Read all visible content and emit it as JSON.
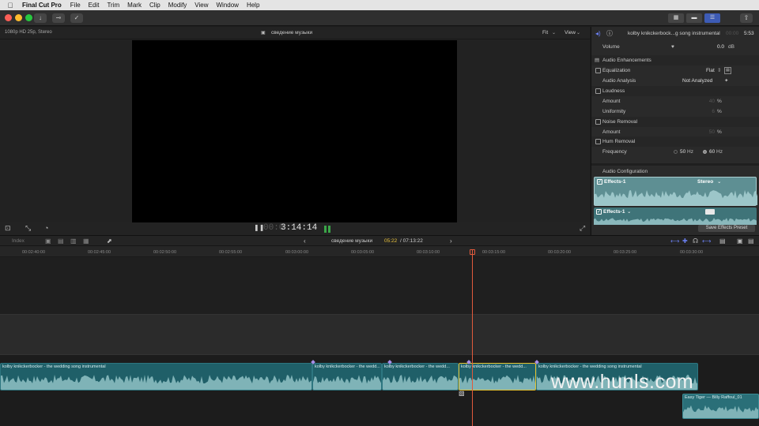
{
  "menubar": {
    "app": "Final Cut Pro",
    "items": [
      "File",
      "Edit",
      "Trim",
      "Mark",
      "Clip",
      "Modify",
      "View",
      "Window",
      "Help"
    ]
  },
  "viewer": {
    "format": "1080p HD 25p, Stereo",
    "title": "сведение музыки",
    "fit": "Fit",
    "view": "View",
    "timecode_dim": "00:0",
    "timecode": "3:14:14"
  },
  "inspector": {
    "clip_name": "kolby knikckerbock...g song instrumental",
    "duration": "5:53",
    "volume_label": "Volume",
    "volume_value": "0.0",
    "volume_unit": "dB",
    "audio_enhancements": "Audio Enhancements",
    "equalization": "Equalization",
    "equalization_value": "Flat",
    "audio_analysis": "Audio Analysis",
    "audio_analysis_value": "Not Analyzed",
    "loudness": "Loudness",
    "amount": "Amount",
    "loudness_amount": "40",
    "percent": "%",
    "uniformity": "Uniformity",
    "uniformity_value": "6",
    "noise_removal": "Noise Removal",
    "noise_amount": "50",
    "hum_removal": "Hum Removal",
    "frequency": "Frequency",
    "freq_50": "50",
    "freq_60": "60",
    "hz": "Hz",
    "audio_configuration": "Audio Configuration",
    "effects_1": "Effects-1",
    "stereo": "Stereo",
    "effects_2": "Effects-1",
    "save_preset": "Save Effects Preset"
  },
  "timeline": {
    "index": "Index",
    "project": "сведение музыки",
    "position": "05:22",
    "total": "/ 07:13:22",
    "ruler": [
      "00:02:40:00",
      "00:02:45:00",
      "00:02:50:00",
      "00:02:55:00",
      "00:03:00:00",
      "00:03:05:00",
      "00:03:10:00",
      "00:03:15:00",
      "00:03:20:00",
      "00:03:25:00",
      "00:03:30:00"
    ],
    "clips": [
      "kolby knikckerbocker - the wedding song instrumental",
      "kolby knikckerbocker - the wedd...",
      "kolby knikckerbocker - the wedd...",
      "kolby knikckerbocker - the wedd...",
      "kolby knikckerbocker - the wedding song instrumental"
    ],
    "second_clip": "Easy Tiger — Billy Raffoul_01"
  },
  "watermark": "www.hunls.com",
  "colors": {
    "audio_clip": "#1f5f68",
    "waveform": "#7fb3b7",
    "playhead": "#e15a3c",
    "selection": "#e4c12f",
    "accent": "#6a7ff0"
  }
}
